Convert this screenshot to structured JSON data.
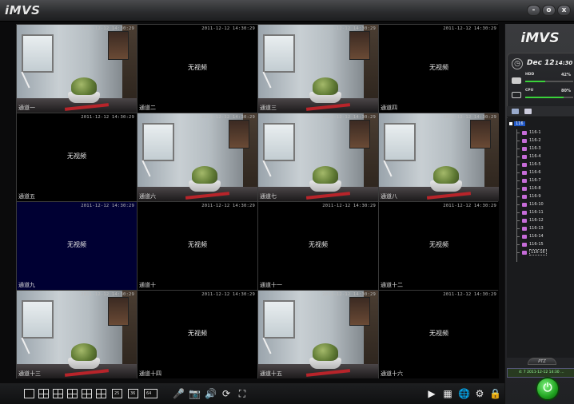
{
  "app": {
    "title": "iMVS",
    "brand": "iMVS"
  },
  "window_buttons": [
    "-",
    "o",
    "x"
  ],
  "timestamp": "2011-12-12 14:30:29",
  "no_video_label": "无视频",
  "cells": [
    {
      "name": "通道一",
      "has_video": true
    },
    {
      "name": "通道二",
      "has_video": false
    },
    {
      "name": "通道三",
      "has_video": true
    },
    {
      "name": "通道四",
      "has_video": false
    },
    {
      "name": "通道五",
      "has_video": false
    },
    {
      "name": "通道六",
      "has_video": true
    },
    {
      "name": "通道七",
      "has_video": true
    },
    {
      "name": "通道八",
      "has_video": true
    },
    {
      "name": "通道九",
      "has_video": false,
      "active": true
    },
    {
      "name": "通道十",
      "has_video": false
    },
    {
      "name": "通道十一",
      "has_video": false
    },
    {
      "name": "通道十二",
      "has_video": false
    },
    {
      "name": "通道十三",
      "has_video": true
    },
    {
      "name": "通道十四",
      "has_video": false
    },
    {
      "name": "通道十五",
      "has_video": true
    },
    {
      "name": "通道十六",
      "has_video": false
    }
  ],
  "status": {
    "date": "Dec 12",
    "time": "14:30",
    "hdd": {
      "label": "HDD",
      "value": "42%",
      "fraction": 0.42
    },
    "cpu": {
      "label": "CPU",
      "value": "80%",
      "fraction": 0.8
    }
  },
  "tree": {
    "root": "116",
    "items": [
      "116-1",
      "116-2",
      "116-3",
      "116-4",
      "116-5",
      "116-6",
      "116-7",
      "116-8",
      "116-9",
      "116-10",
      "116-11",
      "116-12",
      "116-13",
      "116-14",
      "116-15",
      "116-16"
    ]
  },
  "ptz": {
    "tab_label": "PTZ",
    "strip_text": "4: 7 2011-12-12 14:30 …"
  },
  "toolbar": {
    "layouts": [
      "1",
      "4",
      "6",
      "8",
      "9",
      "13",
      "16",
      "25",
      "36",
      "64"
    ],
    "icons": [
      "microphone-icon",
      "camera-icon",
      "speaker-icon",
      "refresh-icon",
      "fullscreen-icon"
    ],
    "right_icons": [
      "play-icon",
      "grid-icon",
      "globe-icon",
      "gear-icon",
      "lock-icon"
    ],
    "layout_tags": [
      "25",
      "36",
      "64"
    ]
  },
  "colors": {
    "accent_green": "#3ad23a",
    "active_cell": "#000033",
    "tree_select": "#1f57c5"
  }
}
